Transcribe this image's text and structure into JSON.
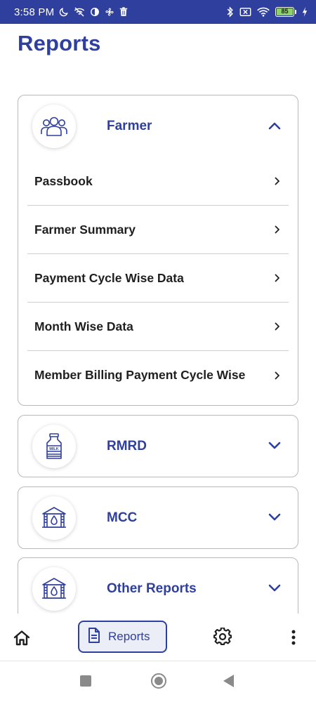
{
  "status_bar": {
    "time": "3:58 PM",
    "battery_level": "85",
    "left_icons": [
      "moon-icon",
      "wifi-off-icon",
      "half-circle-icon",
      "fan-icon",
      "trash-icon"
    ],
    "right_icons": [
      "bluetooth-icon",
      "sim-off-icon",
      "wifi-icon",
      "battery-icon",
      "charging-icon"
    ]
  },
  "page": {
    "title": "Reports"
  },
  "sections": [
    {
      "title": "Farmer",
      "icon": "farmers-group-icon",
      "expanded": true,
      "items": [
        {
          "label": "Passbook"
        },
        {
          "label": "Farmer Summary"
        },
        {
          "label": "Payment Cycle Wise Data"
        },
        {
          "label": "Month Wise Data"
        },
        {
          "label": "Member Billing Payment Cycle Wise"
        }
      ]
    },
    {
      "title": "RMRD",
      "icon": "milk-can-icon",
      "expanded": false,
      "items": []
    },
    {
      "title": "MCC",
      "icon": "milk-center-icon",
      "expanded": false,
      "items": []
    },
    {
      "title": "Other Reports",
      "icon": "milk-center-icon",
      "expanded": false,
      "items": []
    }
  ],
  "bottom_nav": {
    "home_icon": "home-icon",
    "reports_label": "Reports",
    "reports_icon": "document-icon",
    "settings_icon": "gear-icon",
    "more_icon": "more-vertical-icon",
    "active": "Reports"
  },
  "colors": {
    "primary": "#2f3f9e",
    "status_bar": "#2f3f9e",
    "battery": "#8cd16b",
    "active_tab_bg": "#ebedf7"
  }
}
